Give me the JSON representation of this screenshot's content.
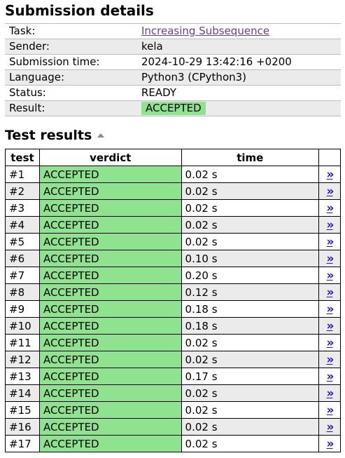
{
  "page": {
    "title": "Submission details"
  },
  "details": {
    "rows": [
      {
        "label": "Task:",
        "value": "Increasing Subsequence"
      },
      {
        "label": "Sender:",
        "value": "kela"
      },
      {
        "label": "Submission time:",
        "value": "2024-10-29 13:42:16 +0200"
      },
      {
        "label": "Language:",
        "value": "Python3 (CPython3)"
      },
      {
        "label": "Status:",
        "value": "READY"
      },
      {
        "label": "Result:",
        "value": "ACCEPTED"
      }
    ]
  },
  "results": {
    "title": "Test results",
    "sort_icon": "triangle-up-icon",
    "headers": [
      "test",
      "verdict",
      "time"
    ],
    "link_icon": "double-chevron-right-icon",
    "link_label": "»",
    "rows": [
      {
        "test": "#1",
        "verdict": "ACCEPTED",
        "time": "0.02 s"
      },
      {
        "test": "#2",
        "verdict": "ACCEPTED",
        "time": "0.02 s"
      },
      {
        "test": "#3",
        "verdict": "ACCEPTED",
        "time": "0.02 s"
      },
      {
        "test": "#4",
        "verdict": "ACCEPTED",
        "time": "0.02 s"
      },
      {
        "test": "#5",
        "verdict": "ACCEPTED",
        "time": "0.02 s"
      },
      {
        "test": "#6",
        "verdict": "ACCEPTED",
        "time": "0.10 s"
      },
      {
        "test": "#7",
        "verdict": "ACCEPTED",
        "time": "0.20 s"
      },
      {
        "test": "#8",
        "verdict": "ACCEPTED",
        "time": "0.12 s"
      },
      {
        "test": "#9",
        "verdict": "ACCEPTED",
        "time": "0.18 s"
      },
      {
        "test": "#10",
        "verdict": "ACCEPTED",
        "time": "0.18 s"
      },
      {
        "test": "#11",
        "verdict": "ACCEPTED",
        "time": "0.02 s"
      },
      {
        "test": "#12",
        "verdict": "ACCEPTED",
        "time": "0.02 s"
      },
      {
        "test": "#13",
        "verdict": "ACCEPTED",
        "time": "0.17 s"
      },
      {
        "test": "#14",
        "verdict": "ACCEPTED",
        "time": "0.02 s"
      },
      {
        "test": "#15",
        "verdict": "ACCEPTED",
        "time": "0.02 s"
      },
      {
        "test": "#16",
        "verdict": "ACCEPTED",
        "time": "0.02 s"
      },
      {
        "test": "#17",
        "verdict": "ACCEPTED",
        "time": "0.02 s"
      }
    ]
  },
  "colors": {
    "accepted_bg": "#8fe38f",
    "row_stripe": "#ebebeb",
    "task_link": "#6a3d9a",
    "details_link": "#1a1ac8"
  }
}
